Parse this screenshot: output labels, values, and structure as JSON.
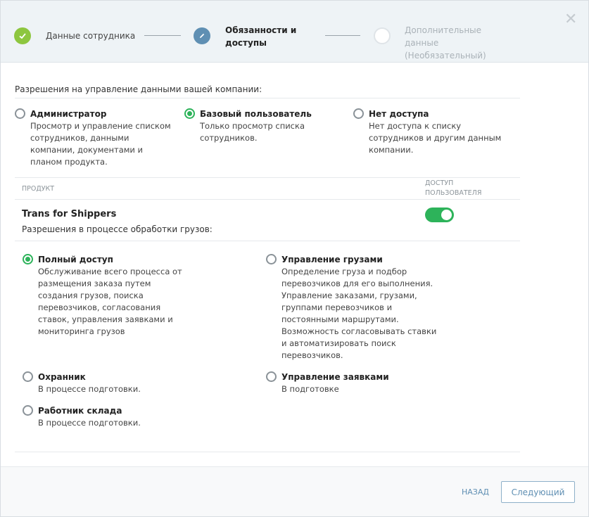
{
  "stepper": {
    "steps": [
      {
        "label": "Данные сотрудника",
        "state": "done"
      },
      {
        "label": "Обязанности и доступы",
        "state": "active"
      },
      {
        "label": "Дополнительные данные (Необязательный)",
        "state": "pending"
      }
    ],
    "close_icon": "close-icon"
  },
  "company": {
    "title": "Разрешения на управление данными вашей компании:",
    "options": [
      {
        "title": "Администратор",
        "desc": "Просмотр и управление списком сотрудников, данными компании, документами и планом продукта.",
        "checked": false
      },
      {
        "title": "Базовый пользователь",
        "desc": "Только просмотр списка сотрудников.",
        "checked": true
      },
      {
        "title": "Нет доступа",
        "desc": "Нет доступа к списку сотрудников и другим данным компании.",
        "checked": false
      }
    ]
  },
  "table": {
    "col_product": "ПРОДУКТ",
    "col_access": "ДОСТУП ПОЛЬЗОВАТЕЛЯ"
  },
  "product": {
    "name": "Trans for Shippers",
    "subtitle": "Разрешения в процессе обработки грузов:",
    "access_enabled": true,
    "roles": [
      {
        "title": "Полный доступ",
        "desc": "Обслуживание всего процесса от размещения заказа путем создания грузов, поиска перевозчиков, согласования ставок, управления заявками и мониторинга грузов",
        "checked": true
      },
      {
        "title": "Управление грузами",
        "desc": "Определение груза и подбор перевозчиков для его выполнения. Управление заказами, грузами, группами перевозчиков и постоянными маршрутами. Возможность согласовывать ставки и автоматизировать поиск перевозчиков.",
        "checked": false
      },
      {
        "title": "Охранник",
        "desc": "В процессе подготовки.",
        "checked": false
      },
      {
        "title": "Управление заявками",
        "desc": "В подготовке",
        "checked": false
      },
      {
        "title": "Работник склада",
        "desc": "В процессе подготовки.",
        "checked": false
      }
    ]
  },
  "footer": {
    "back_label": "НАЗАД",
    "next_label": "Следующий"
  },
  "colors": {
    "accent_green": "#2db35a",
    "step_done": "#8dc63f",
    "step_active": "#5f8fb3",
    "link_blue": "#5f8fb3"
  }
}
